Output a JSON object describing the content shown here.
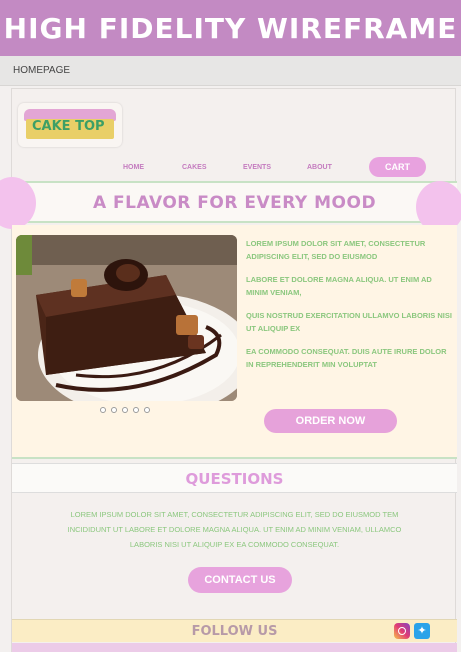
{
  "banner": {
    "title": "High Fidelity Wireframe"
  },
  "breadcrumb": {
    "label": "HOMEPAGE"
  },
  "logo": {
    "text": "CAKE TOP"
  },
  "nav": {
    "items": [
      "HOME",
      "CAKES",
      "EVENTS",
      "ABOUT"
    ],
    "cart": "CART"
  },
  "hero": {
    "title": "A FLAVOR FOR EVERY MOOD"
  },
  "feature": {
    "paragraphs": [
      "LOREM IPSUM DOLOR SIT AMET, CONSECTETUR ADIPISCING ELIT, SED DO EIUSMOD",
      "LABORE ET DOLORE MAGNA ALIQUA. UT ENIM AD MINIM VENIAM,",
      "QUIS NOSTRUD EXERCITATION ULLAMVO LABORIS NISI UT ALIQUIP EX",
      "EA COMMODO CONSEQUAT. DUIS AUTE IRURE DOLOR IN REPREHENDERIT  MIN VOLUPTAT"
    ],
    "order_button": "ORDER NOW"
  },
  "questions": {
    "title": "QUESTIONS",
    "text": "LOREM IPSUM DOLOR SIT AMET, CONSECTETUR ADIPISCING ELIT, SED DO EIUSMOD TEM INCIDIDUNT UT LABORE ET DOLORE MAGNA ALIQUA. UT ENIM AD MINIM VENIAM, ULLAMCO LABORIS NISI UT ALIQUIP EX EA COMMODO CONSEQUAT.",
    "contact_button": "CONTACT US"
  },
  "follow": {
    "title": "FOLLOW US",
    "icons": [
      "instagram-icon",
      "twitter-icon"
    ]
  },
  "colors": {
    "accent_pink": "#e6a2da",
    "green_text": "#8bc77e",
    "banner": "#c38ac3"
  }
}
